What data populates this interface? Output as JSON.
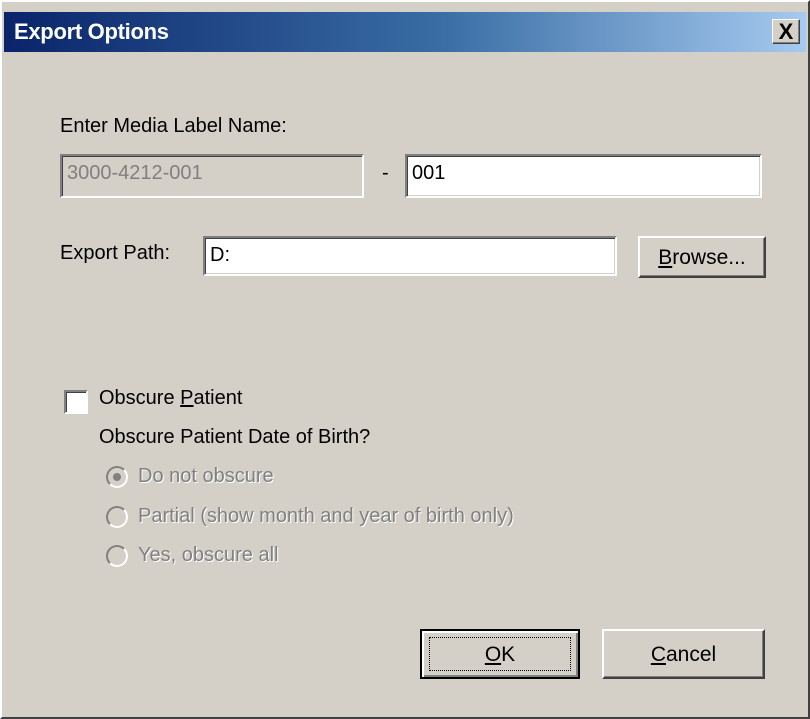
{
  "window": {
    "title": "Export Options",
    "close_glyph": "X"
  },
  "media_label": {
    "label": "Enter Media Label Name:",
    "prefix_value": "3000-4212-001",
    "separator": "-",
    "suffix_value": "001"
  },
  "export_path": {
    "label": "Export Path:",
    "value": "D:",
    "browse_label": "Browse...",
    "browse_mnemonic": "B",
    "browse_rest": "rowse..."
  },
  "obscure": {
    "checkbox_label_pre": "Obscure ",
    "checkbox_label_mn": "P",
    "checkbox_label_post": "atient",
    "checked": false,
    "dob_question": "Obscure Patient Date of Birth?",
    "options": [
      {
        "label": "Do not obscure",
        "selected": true,
        "enabled": false
      },
      {
        "label": "Partial (show month and year of birth only)",
        "selected": false,
        "enabled": false
      },
      {
        "label": "Yes, obscure all",
        "selected": false,
        "enabled": false
      }
    ]
  },
  "buttons": {
    "ok_mnemonic": "O",
    "ok_rest": "K",
    "cancel_mnemonic": "C",
    "cancel_rest": "ancel"
  },
  "icons": {
    "close": "close-icon",
    "radio_selected": "radio-selected-icon",
    "radio_unselected": "radio-unselected-icon",
    "checkbox": "checkbox-icon"
  },
  "colors": {
    "face": "#d4d0c8",
    "title_start": "#0a246a",
    "title_end": "#a6caf0",
    "disabled_text": "#808080"
  }
}
